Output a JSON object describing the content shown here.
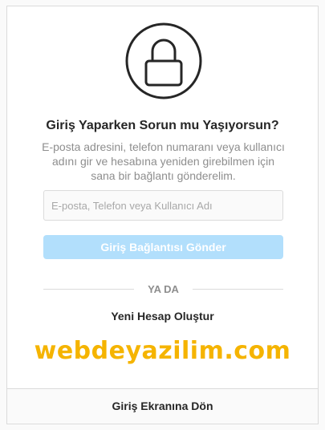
{
  "title": "Giriş Yaparken Sorun mu Yaşıyorsun?",
  "description": "E-posta adresini, telefon numaranı veya kullanıcı adını gir ve hesabına yeniden girebilmen için sana bir bağlantı gönderelim.",
  "input": {
    "placeholder": "E-posta, Telefon veya Kullanıcı Adı",
    "value": ""
  },
  "send_button_label": "Giriş Bağlantısı Gönder",
  "divider_label": "YA DA",
  "create_account_label": "Yeni Hesap Oluştur",
  "watermark": "webdeyazilim.com",
  "back_label": "Giriş Ekranına Dön",
  "colors": {
    "button_disabled": "#b2dffc",
    "watermark": "#f5b400",
    "border": "#dbdbdb",
    "text": "#262626",
    "muted": "#8e8e8e"
  },
  "icons": {
    "header": "lock-icon"
  }
}
